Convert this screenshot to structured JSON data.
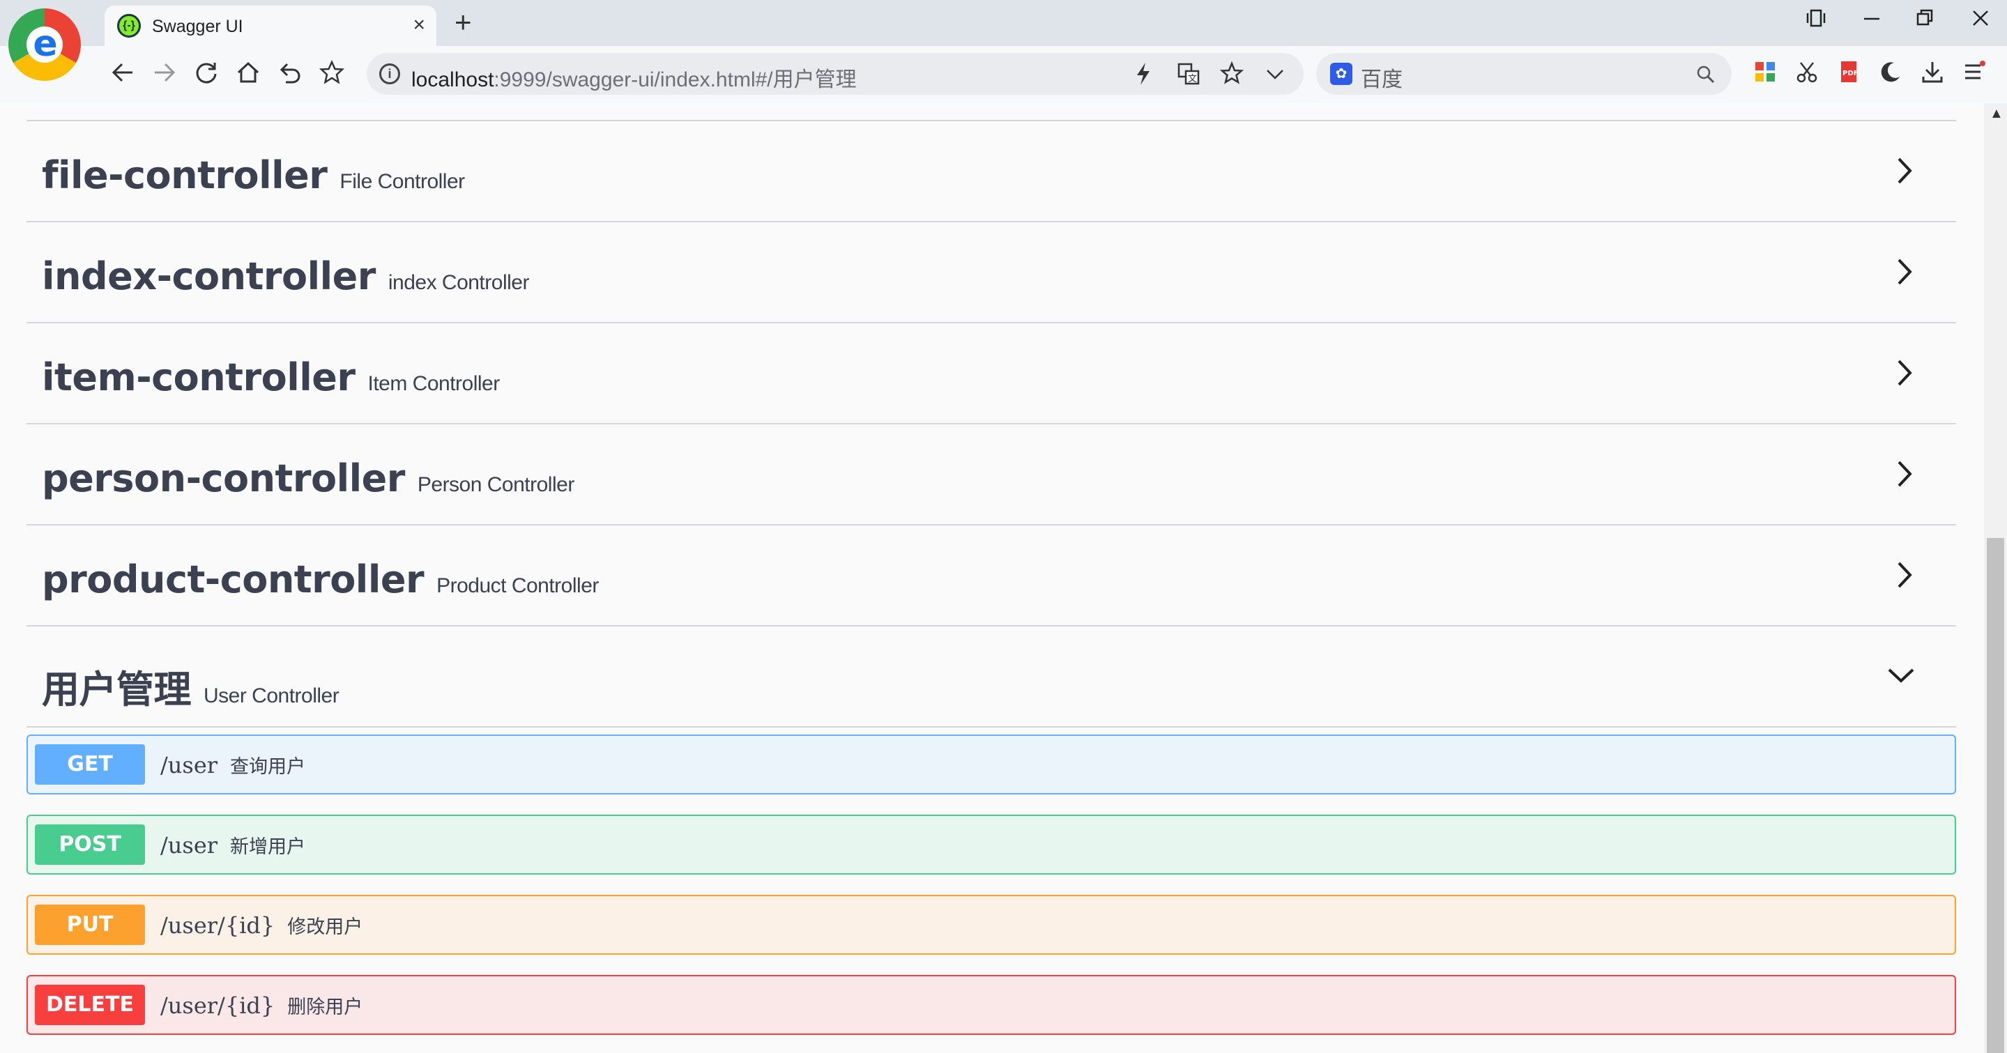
{
  "browser": {
    "tab_title": "Swagger UI",
    "tab_favicon": "{-}",
    "tab_close": "×",
    "new_tab": "+",
    "address_host": "localhost",
    "address_path": ":9999/swagger-ui/index.html#/用户管理",
    "search_placeholder": "百度",
    "icons": [
      "back-icon",
      "forward-icon",
      "reload-icon",
      "home-icon",
      "undo-icon",
      "star-icon",
      "lightning-icon",
      "translate-icon",
      "bookmark-star-icon",
      "chevron-down-icon",
      "search-icon",
      "apps-icon",
      "scissors-icon",
      "pdf-icon",
      "moon-icon",
      "download-icon",
      "menu-icon"
    ]
  },
  "tags": [
    {
      "name": "file-controller",
      "description": "File Controller",
      "expanded": false
    },
    {
      "name": "index-controller",
      "description": "index Controller",
      "expanded": false
    },
    {
      "name": "item-controller",
      "description": "Item Controller",
      "expanded": false
    },
    {
      "name": "person-controller",
      "description": "Person Controller",
      "expanded": false
    },
    {
      "name": "product-controller",
      "description": "Product Controller",
      "expanded": false
    },
    {
      "name": "用户管理",
      "description": "User Controller",
      "expanded": true
    }
  ],
  "operations": [
    {
      "method": "GET",
      "path": "/user",
      "summary": "查询用户",
      "color": "#61affe",
      "bg": "#ebf3fb"
    },
    {
      "method": "POST",
      "path": "/user",
      "summary": "新增用户",
      "color": "#49cc90",
      "bg": "#e8f6f0"
    },
    {
      "method": "PUT",
      "path": "/user/{id}",
      "summary": "修改用户",
      "color": "#fca130",
      "bg": "#fbf1e6"
    },
    {
      "method": "DELETE",
      "path": "/user/{id}",
      "summary": "删除用户",
      "color": "#f93e3e",
      "bg": "#fae7e7"
    }
  ]
}
